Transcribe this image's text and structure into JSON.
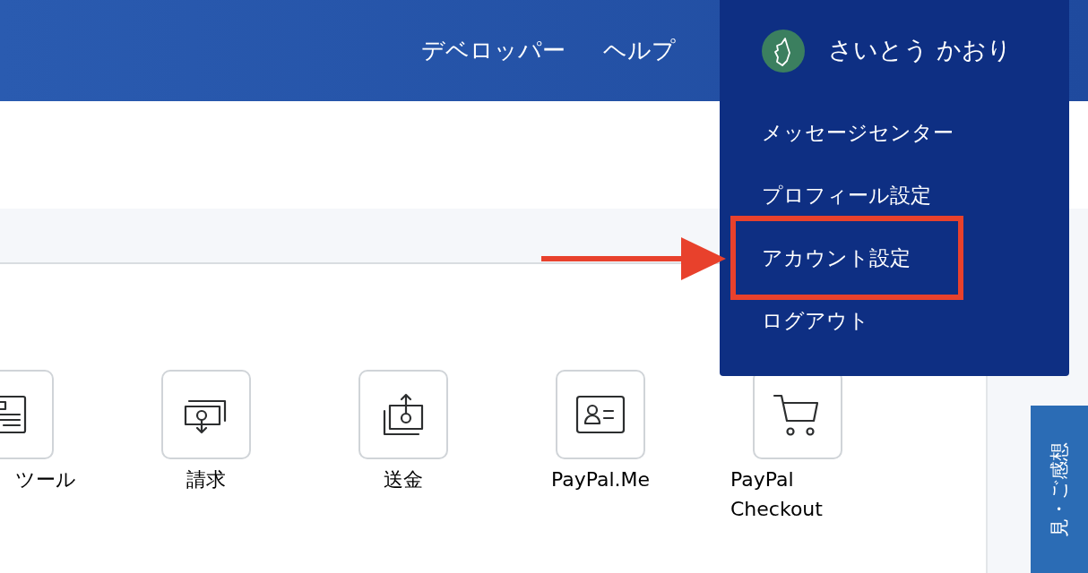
{
  "header": {
    "nav": [
      {
        "label": "デベロッパー"
      },
      {
        "label": "ヘルプ"
      }
    ]
  },
  "user_menu": {
    "name": "さいとう かおり",
    "expanded": true,
    "items": [
      {
        "label": "メッセージセンター",
        "highlighted": false
      },
      {
        "label": "プロフィール設定",
        "highlighted": false
      },
      {
        "label": "アカウント設定",
        "highlighted": true
      },
      {
        "label": "ログアウト",
        "highlighted": false
      }
    ]
  },
  "tools": [
    {
      "label": "ツール",
      "kind": "document"
    },
    {
      "label": "請求",
      "kind": "request"
    },
    {
      "label": "送金",
      "kind": "send"
    },
    {
      "label": "PayPal.Me",
      "kind": "profile"
    },
    {
      "label": "PayPal Checkout",
      "kind": "cart"
    }
  ],
  "feedback_tab": {
    "label": "見・ご感想"
  }
}
